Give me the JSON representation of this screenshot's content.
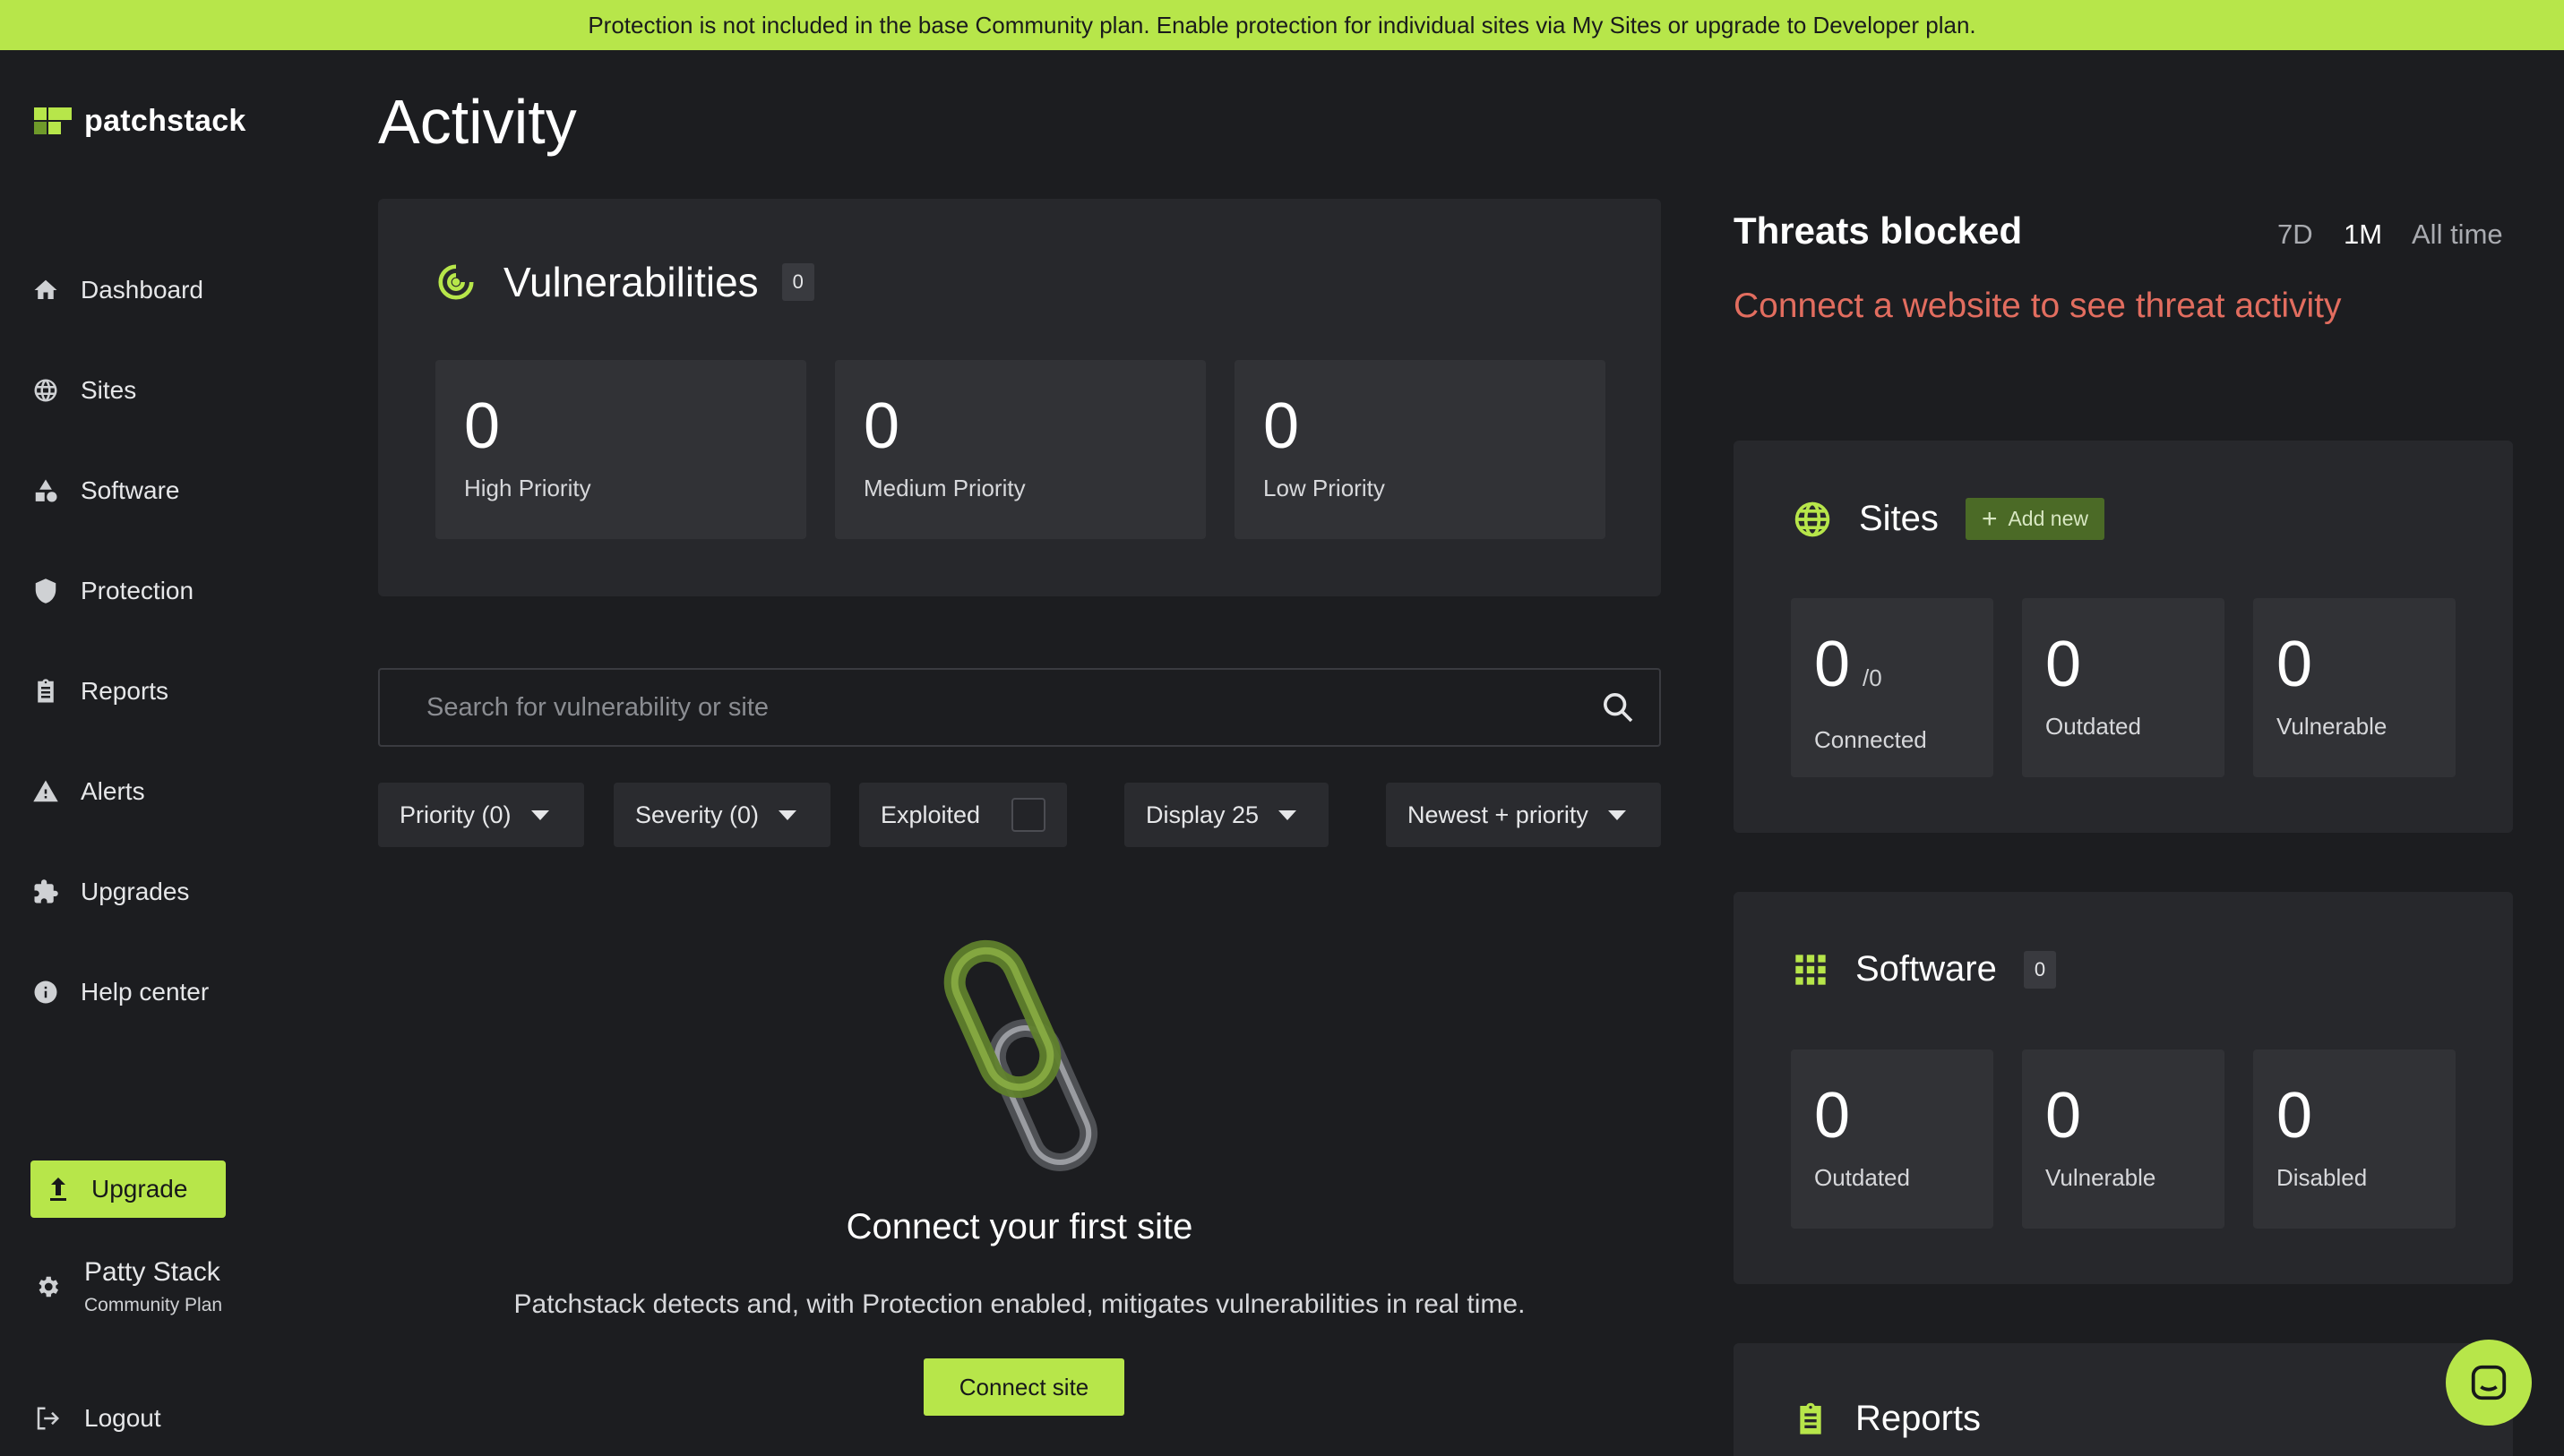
{
  "banner": {
    "text": "Protection is not included in the base Community plan. Enable protection for individual sites via My Sites or upgrade to Developer plan."
  },
  "brand": {
    "name": "patchstack",
    "accent": "#b7e64a"
  },
  "sidebar": {
    "items": [
      {
        "label": "Dashboard",
        "icon": "home-icon"
      },
      {
        "label": "Sites",
        "icon": "globe-icon"
      },
      {
        "label": "Software",
        "icon": "shapes-icon"
      },
      {
        "label": "Protection",
        "icon": "shield-icon"
      },
      {
        "label": "Reports",
        "icon": "clipboard-icon"
      },
      {
        "label": "Alerts",
        "icon": "warning-icon"
      },
      {
        "label": "Upgrades",
        "icon": "puzzle-icon"
      },
      {
        "label": "Help center",
        "icon": "info-icon"
      }
    ],
    "upgrade_label": "Upgrade",
    "user": {
      "name": "Patty Stack",
      "plan": "Community Plan"
    },
    "logout_label": "Logout"
  },
  "page": {
    "title": "Activity"
  },
  "vulnerabilities": {
    "title": "Vulnerabilities",
    "count": "0",
    "stats": [
      {
        "value": "0",
        "label": "High Priority"
      },
      {
        "value": "0",
        "label": "Medium Priority"
      },
      {
        "value": "0",
        "label": "Low Priority"
      }
    ]
  },
  "search": {
    "placeholder": "Search for vulnerability or site",
    "value": ""
  },
  "filters": {
    "priority": "Priority (0)",
    "severity": "Severity (0)",
    "exploited": "Exploited",
    "display": "Display 25",
    "sort": "Newest + priority"
  },
  "empty_state": {
    "title": "Connect your first site",
    "text": "Patchstack detects and, with Protection enabled, mitigates vulnerabilities in real time.",
    "button": "Connect site"
  },
  "threats": {
    "title": "Threats blocked",
    "ranges": [
      "7D",
      "1M",
      "All time"
    ],
    "active_range": "1M",
    "message": "Connect a website to see threat activity",
    "message_color": "#e26d5f"
  },
  "sites": {
    "title": "Sites",
    "add_label": "Add new",
    "stats": [
      {
        "value": "0",
        "suffix": "/0",
        "label": "Connected"
      },
      {
        "value": "0",
        "label": "Outdated"
      },
      {
        "value": "0",
        "label": "Vulnerable"
      }
    ]
  },
  "software": {
    "title": "Software",
    "count": "0",
    "stats": [
      {
        "value": "0",
        "label": "Outdated"
      },
      {
        "value": "0",
        "label": "Vulnerable"
      },
      {
        "value": "0",
        "label": "Disabled"
      }
    ]
  },
  "reports": {
    "title": "Reports"
  }
}
